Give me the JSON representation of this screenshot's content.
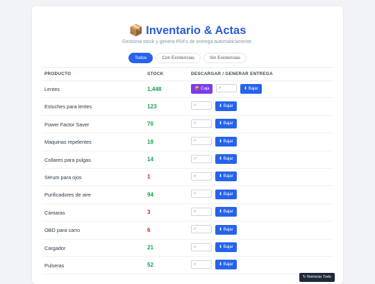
{
  "header": {
    "title_icon": "📦",
    "title": "Inventario & Actas",
    "subtitle": "Gestiona stock y genera PDFs de entrega automáticamente."
  },
  "filters": [
    {
      "label": "Todos",
      "active": true
    },
    {
      "label": "Con Existencias",
      "active": false
    },
    {
      "label": "Sin Existencias",
      "active": false
    }
  ],
  "table": {
    "columns": [
      "PRODUCTO",
      "STOCK",
      "DESCARGAR / GENERAR ENTREGA"
    ],
    "qty_placeholder": "#",
    "bajar_label": "⬇ Bajar",
    "caja_label": "📦 Caja",
    "rows": [
      {
        "name": "Lentes",
        "stock": "1,448",
        "status": "ok",
        "has_caja": true
      },
      {
        "name": "Estuches para lentes",
        "stock": "123",
        "status": "ok",
        "has_caja": false
      },
      {
        "name": "Power Factor Saver",
        "stock": "70",
        "status": "ok",
        "has_caja": false
      },
      {
        "name": "Maquinas repelentes",
        "stock": "18",
        "status": "ok",
        "has_caja": false
      },
      {
        "name": "Collares para pulgas",
        "stock": "14",
        "status": "ok",
        "has_caja": false
      },
      {
        "name": "Sérum para ojos",
        "stock": "1",
        "status": "low",
        "has_caja": false
      },
      {
        "name": "Purificadores de aire",
        "stock": "94",
        "status": "ok",
        "has_caja": false
      },
      {
        "name": "Cámaras",
        "stock": "3",
        "status": "low",
        "has_caja": false
      },
      {
        "name": "OBD para carro",
        "stock": "6",
        "status": "low",
        "has_caja": false
      },
      {
        "name": "Cargador",
        "stock": "21",
        "status": "ok",
        "has_caja": false
      },
      {
        "name": "Pulseras",
        "stock": "52",
        "status": "ok",
        "has_caja": false
      }
    ]
  },
  "footer": {
    "reset_label": "↻ Reiniciar Todo"
  },
  "colors": {
    "primary": "#2563eb",
    "caja": "#7c3aed",
    "stock_ok": "#16a34a",
    "stock_low": "#dc2626"
  }
}
